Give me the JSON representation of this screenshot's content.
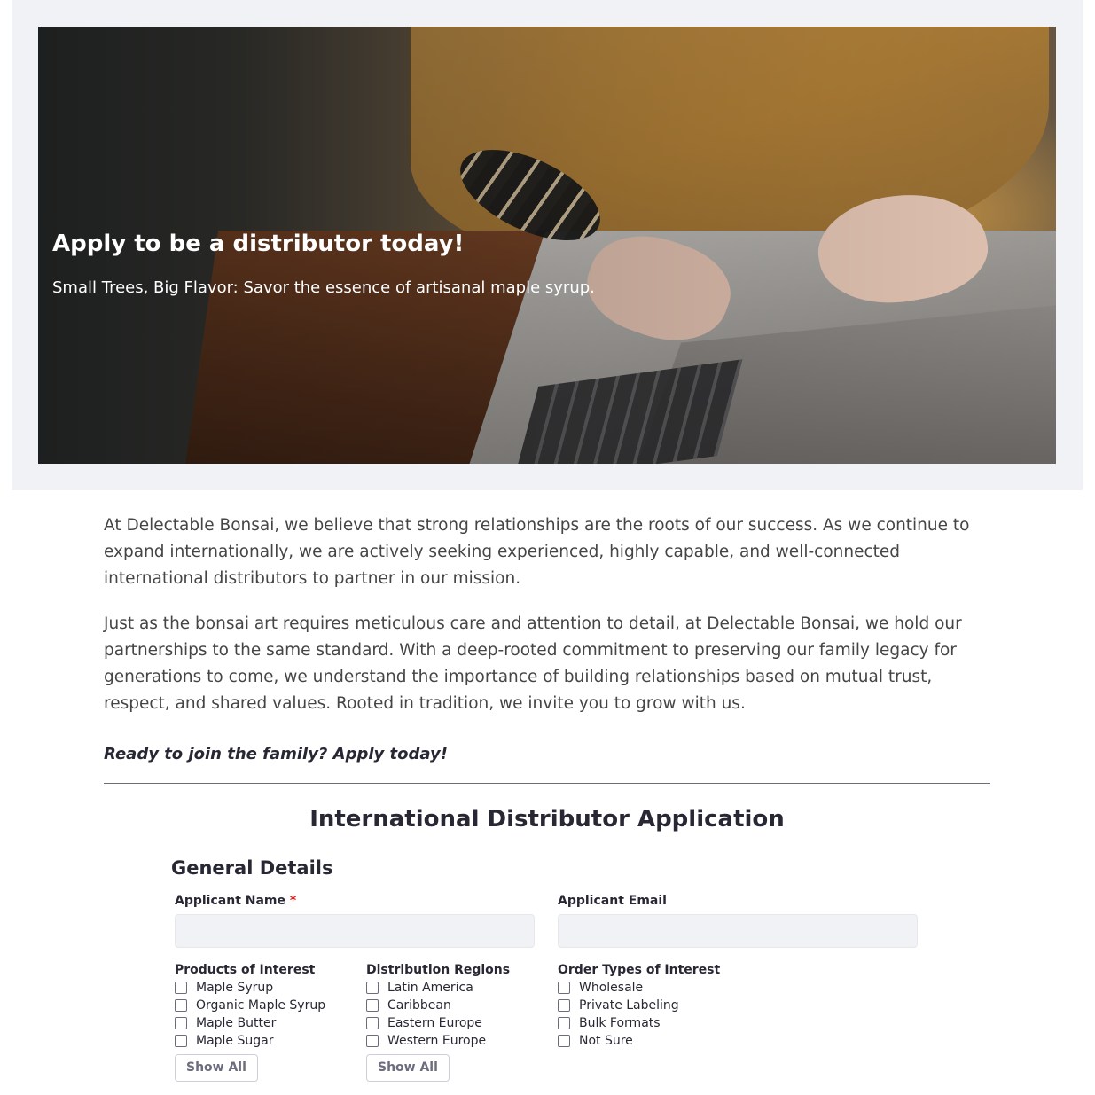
{
  "hero": {
    "title": "Apply to be a distributor today!",
    "subtitle": "Small Trees, Big Flavor: Savor the essence of artisanal maple syrup."
  },
  "intro": {
    "paragraph_1": "At Delectable Bonsai, we believe that strong relationships are the roots of our success. As we continue to expand internationally, we are actively seeking experienced, highly capable, and well-connected international distributors to partner in our mission.",
    "paragraph_2": "Just as the bonsai art requires meticulous care and attention to detail, at Delectable Bonsai, we hold our partnerships to the same standard. With a deep-rooted commitment to preserving our family legacy for generations to come, we understand the importance of building relationships based on mutual trust, respect, and shared values. Rooted in tradition, we invite you to grow with us.",
    "cta": "Ready to join the family? Apply today!"
  },
  "form": {
    "title": "International Distributor Application",
    "section_title": "General Details",
    "applicant_name": {
      "label": "Applicant Name",
      "required_mark": "*",
      "value": ""
    },
    "applicant_email": {
      "label": "Applicant Email",
      "value": ""
    },
    "products": {
      "label": "Products of Interest",
      "options": [
        "Maple Syrup",
        "Organic Maple Syrup",
        "Maple Butter",
        "Maple Sugar"
      ],
      "show_all_label": "Show All"
    },
    "regions": {
      "label": "Distribution Regions",
      "options": [
        "Latin America",
        "Caribbean",
        "Eastern Europe",
        "Western Europe"
      ],
      "show_all_label": "Show All"
    },
    "order_types": {
      "label": "Order Types of Interest",
      "options": [
        "Wholesale",
        "Private Labeling",
        "Bulk Formats",
        "Not Sure"
      ]
    }
  }
}
